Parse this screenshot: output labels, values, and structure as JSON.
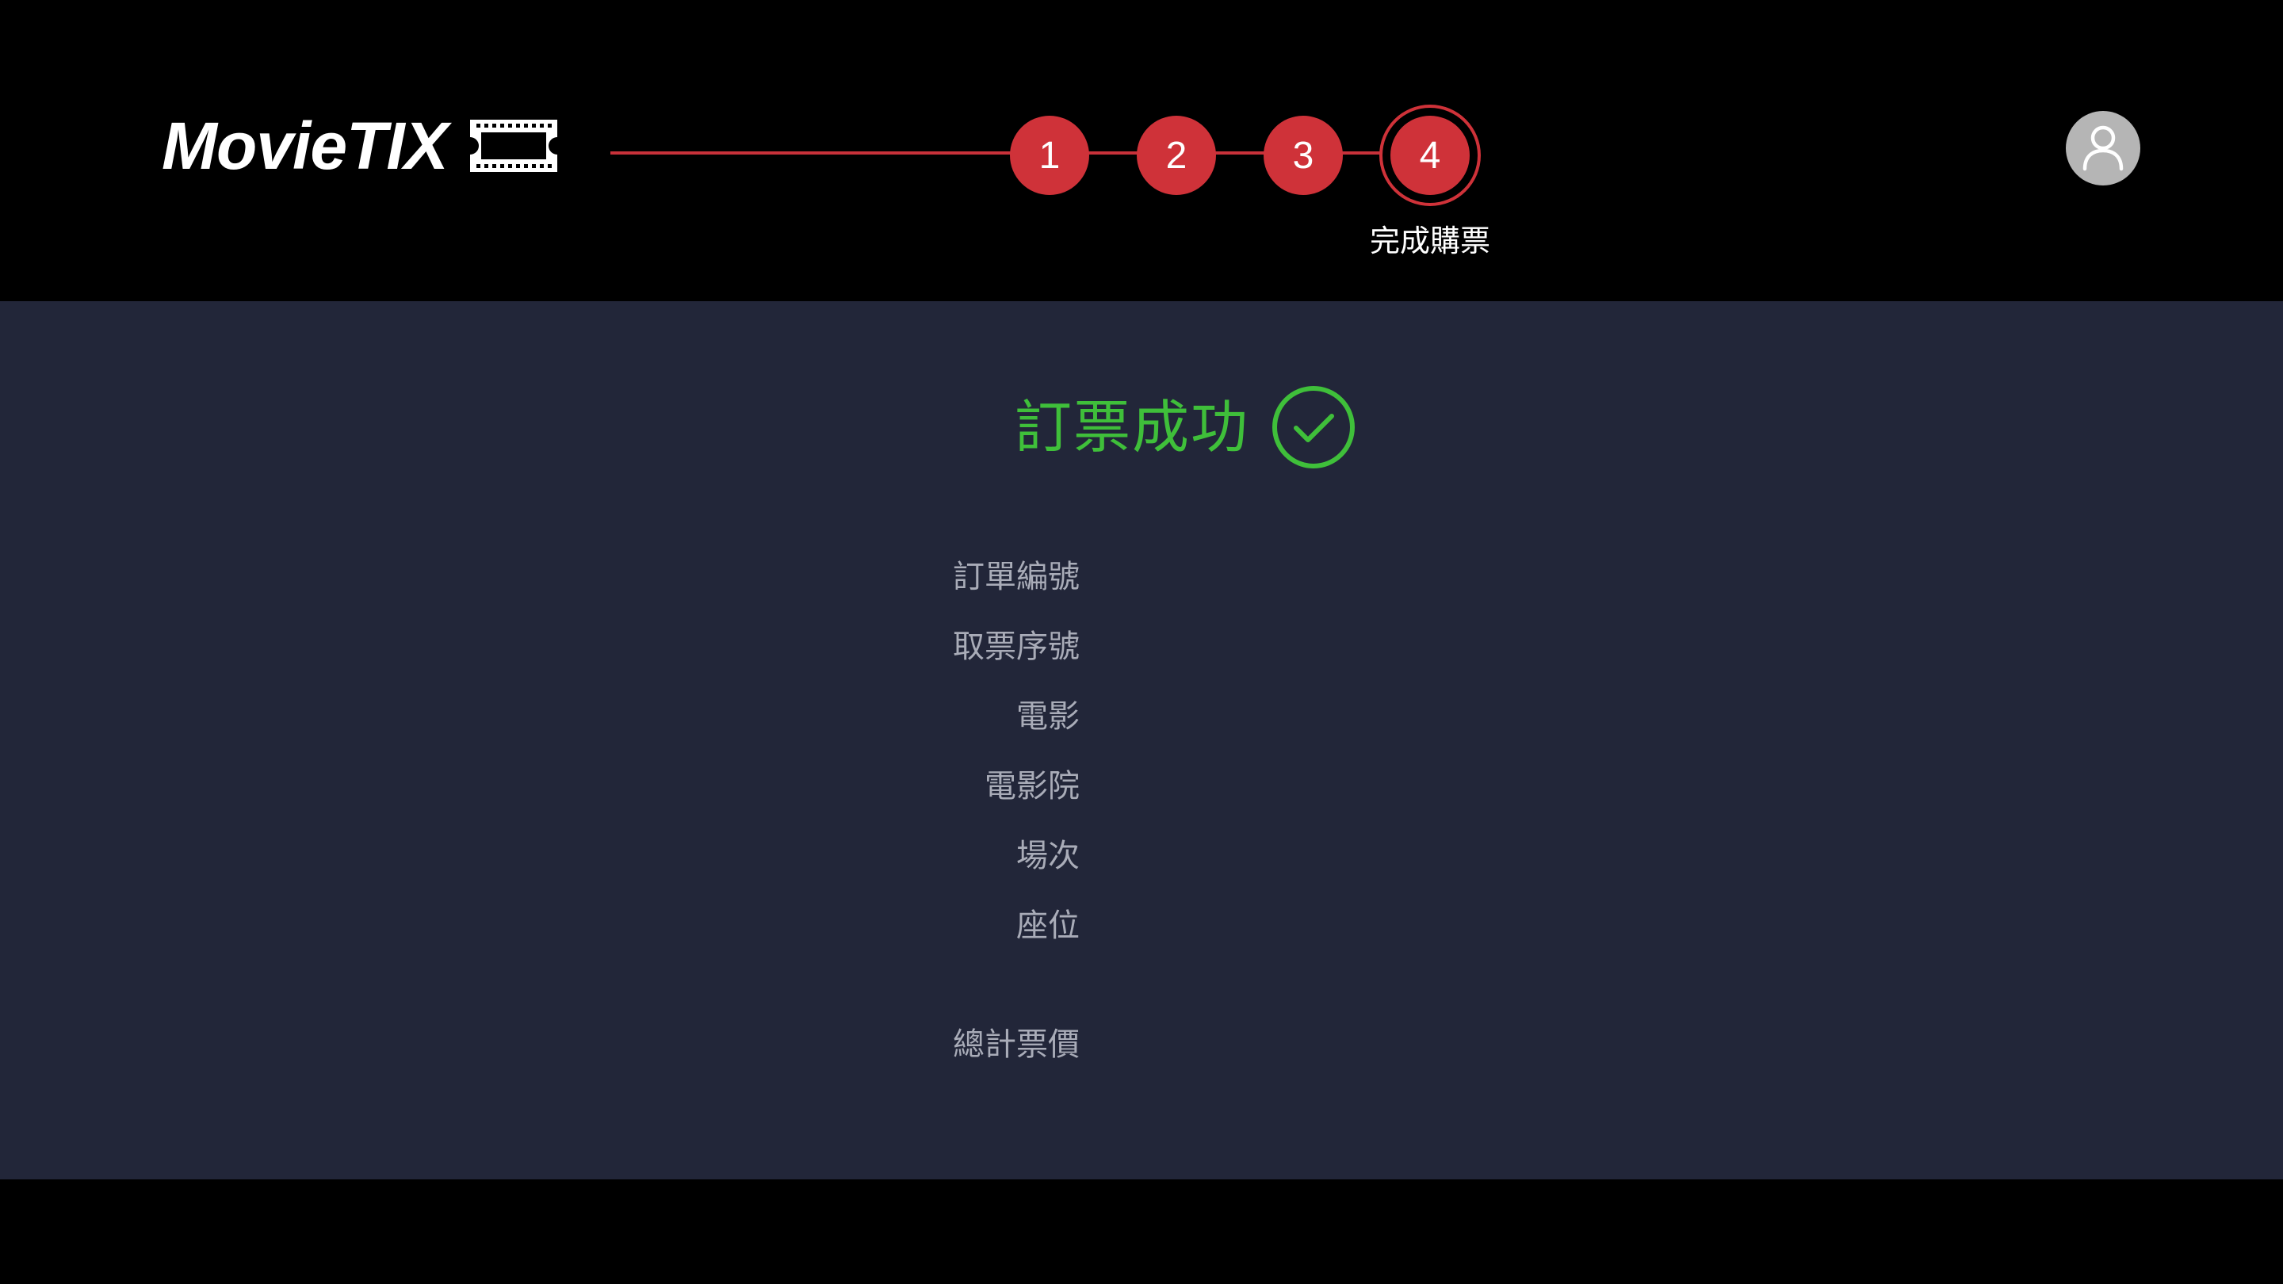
{
  "brand": {
    "name": "MovieTIX",
    "icon": "ticket-icon"
  },
  "steps": {
    "items": [
      {
        "number": "1"
      },
      {
        "number": "2"
      },
      {
        "number": "3"
      },
      {
        "number": "4"
      }
    ],
    "current_caption": "完成購票",
    "accent_color": "#cf3239"
  },
  "user": {
    "icon": "user-icon"
  },
  "result": {
    "title": "訂票成功",
    "icon": "check-circle-icon",
    "color": "#3fbf3a"
  },
  "details": {
    "order_number_label": "訂單編號",
    "ticket_serial_label": "取票序號",
    "movie_label": "電影",
    "cinema_label": "電影院",
    "showtime_label": "場次",
    "seat_label": "座位",
    "total_price_label": "總計票價"
  },
  "colors": {
    "header_bg": "#000000",
    "main_bg": "#222639",
    "label_text": "#a9acb8"
  }
}
